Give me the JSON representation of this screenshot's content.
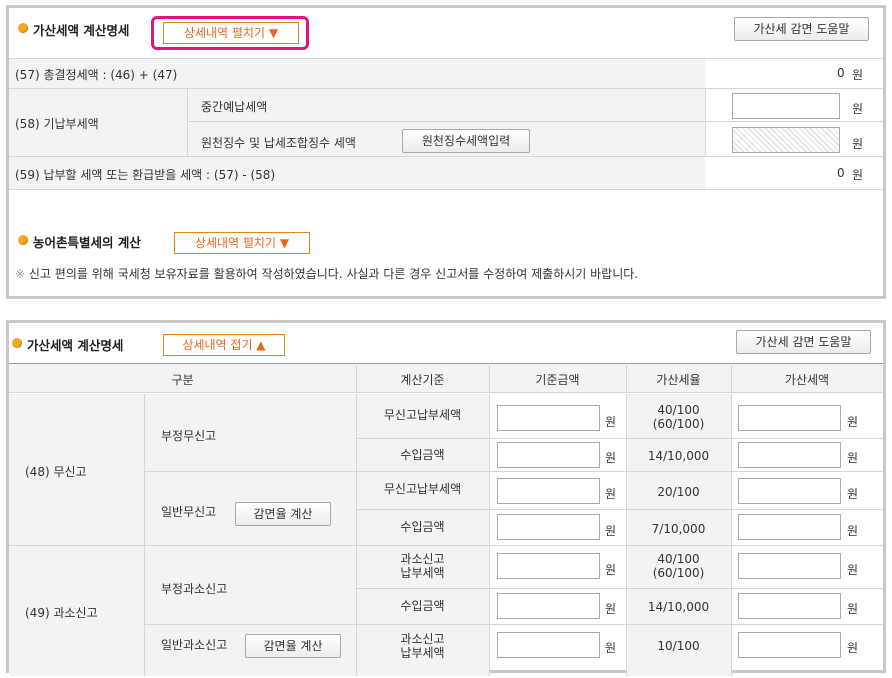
{
  "panel1": {
    "title": "가산세액 계산명세",
    "expand_label": "상세내역 펼치기 ▼",
    "help_button": "가산세 감면 도움말",
    "row57": {
      "label": "(57) 총결정세액 : (46) + (47)",
      "value": "0",
      "unit": "원"
    },
    "row58": {
      "label": "(58) 기납부세액",
      "sub1_label": "중간예납세액",
      "sub1_unit": "원",
      "sub2_label": "원천징수 및 납세조합징수 세액",
      "sub2_button": "원천징수세액입력",
      "sub2_unit": "원"
    },
    "row59": {
      "label": "(59) 납부할 세액 또는 환급받을 세액 : (57) - (58)",
      "value": "0",
      "unit": "원"
    },
    "rural_title": "농어촌특별세의 계산",
    "rural_expand_label": "상세내역 펼치기 ▼",
    "note_mark": "※",
    "note": "신고 편의를 위해 국세청 보유자료를 활용하여 작성하였습니다. 사실과 다른 경우 신고서를 수정하여 제출하시기 바랍니다."
  },
  "panel2": {
    "title": "가산세액 계산명세",
    "collapse_label": "상세내역 접기 ▲",
    "help_button": "가산세 감면 도움말",
    "headers": [
      "구분",
      "계산기준",
      "기준금액",
      "가산세율",
      "가산세액"
    ],
    "unit": "원",
    "reduce_button": "감면율 계산",
    "g48": {
      "label": "(48) 무신고",
      "sub1": "부정무신고",
      "sub2": "일반무신고",
      "r1": {
        "basis": "무신고납부세액",
        "rate": "40/100\n(60/100)"
      },
      "r2": {
        "basis": "수입금액",
        "rate": "14/10,000"
      },
      "r3": {
        "basis": "무신고납부세액",
        "rate": "20/100"
      },
      "r4": {
        "basis": "수입금액",
        "rate": "7/10,000"
      }
    },
    "g49": {
      "label": "(49) 과소신고",
      "sub1": "부정과소신고",
      "sub2": "일반과소신고",
      "r1": {
        "basis": "과소신고\n납부세액",
        "rate": "40/100\n(60/100)"
      },
      "r2": {
        "basis": "수입금액",
        "rate": "14/10,000"
      },
      "r3": {
        "basis": "과소신고\n납부세액",
        "rate": "10/100"
      }
    }
  },
  "colors": {
    "accent_orange": "#e8671e",
    "highlight_pink": "#e0157f",
    "bullet": "#f5a623"
  }
}
